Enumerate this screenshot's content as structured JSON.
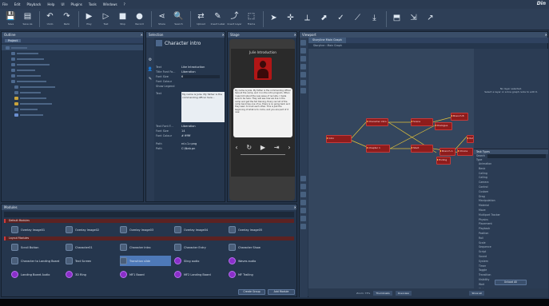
{
  "menu": [
    "File",
    "Edit",
    "Playback",
    "Help",
    "UI",
    "Plugins",
    "Tools",
    "Windows",
    "?"
  ],
  "toolbar": [
    {
      "icon": "💾",
      "label": "Save"
    },
    {
      "icon": "▤",
      "label": "Save As"
    },
    {
      "icon": "↶",
      "label": "Undo"
    },
    {
      "icon": "↷",
      "label": "Redo"
    },
    {
      "icon": "▶",
      "label": "Play"
    },
    {
      "icon": "▷",
      "label": "Test"
    },
    {
      "icon": "■",
      "label": "Stop"
    },
    {
      "icon": "●",
      "label": "Record"
    },
    {
      "icon": "⋖",
      "label": "Share"
    },
    {
      "icon": "🔍",
      "label": "Search"
    },
    {
      "icon": "⇄",
      "label": "Upload"
    },
    {
      "icon": "✎",
      "label": "Insert Label"
    },
    {
      "icon": "⤴",
      "label": "Insert Layer"
    },
    {
      "icon": "⬚",
      "label": "Frame"
    },
    {
      "icon": "➤",
      "label": ""
    },
    {
      "icon": "✛",
      "label": ""
    },
    {
      "icon": "⟂",
      "label": ""
    },
    {
      "icon": "⬈",
      "label": ""
    },
    {
      "icon": "✓",
      "label": ""
    },
    {
      "icon": "⟋",
      "label": ""
    },
    {
      "icon": "⤓",
      "label": ""
    },
    {
      "icon": "⬒",
      "label": ""
    },
    {
      "icon": "⇲",
      "label": ""
    },
    {
      "icon": "↗",
      "label": ""
    }
  ],
  "logo": "Din",
  "left_panel": {
    "title": "Outline",
    "tab": "Project"
  },
  "selection_panel": {
    "title": "Selection",
    "header": "Character intro"
  },
  "properties": [
    {
      "k": "Text",
      "v": "Like Introduction"
    },
    {
      "k": "Title Font Fa...",
      "v": "Liberation"
    },
    {
      "k": "Font Size",
      "v": "6"
    },
    {
      "k": "Font Colour",
      "v": ""
    },
    {
      "k": "Show Legend",
      "v": ""
    },
    {
      "k": "Text",
      "v": "My name is Julie. My father is the commanding officer here..."
    },
    {
      "k": "Text Font F...",
      "v": "Liberation"
    },
    {
      "k": "Font Size",
      "v": "14"
    },
    {
      "k": "Font Colour",
      "v": "# ffffff"
    },
    {
      "k": "Path",
      "v": "rd.r.1.r.png"
    },
    {
      "k": "Path",
      "v": "C:\\Nab.pn"
    }
  ],
  "stage": {
    "title": "Stage",
    "card_title": "Julie Introduction",
    "body": "My name is Julie. My father is the commanding officer here at the camp, and I run the intro program. When I was told about the new wave of recruits, I made sure to be here. They will see how we live in the camp and get the full training. Every recruit of the camp becomes one of us, there is no going back and they learn to trust each other. This is just the beginning of what is to come, and you are part of it now."
  },
  "graph_panel": {
    "title": "Viewport",
    "tab": "Storyline Main Graph",
    "crumb1": "Storyline",
    "crumb2": "Main Graph",
    "hint1": "No layer selected.",
    "hint2": "Select a layer or a line graph node to edit it.",
    "zoom": "Zoom: 73%",
    "btn_thumbs": "Thumbnails",
    "btn_overview": "Overview",
    "btn_show": "Show all"
  },
  "nodes": [
    {
      "label": "Intro"
    },
    {
      "label": "Character intro"
    },
    {
      "label": "Chapter 1"
    },
    {
      "label": "Scene"
    },
    {
      "label": "Start"
    },
    {
      "label": "Dialogue"
    },
    {
      "label": "Branch A"
    },
    {
      "label": "Branch B"
    },
    {
      "label": "Choice"
    },
    {
      "label": "Outro"
    },
    {
      "label": "Ending"
    }
  ],
  "task_panel": {
    "title": "Task Types",
    "search_label": "Search",
    "type_label": "Type",
    "btn": "Unload All"
  },
  "task_types": [
    "Animation",
    "Basic",
    "Calling",
    "Calling",
    "Camera",
    "Control",
    "Custom",
    "Drag",
    "Manipulation",
    "Material",
    "Move",
    "Multipart Tracker",
    "Physics",
    "Placement",
    "Playback",
    "Position",
    "Roll",
    "Scale",
    "Sequence",
    "Script",
    "Sound",
    "System",
    "Timer",
    "Toggle",
    "Transition",
    "Visibility",
    "Wait",
    "Web"
  ],
  "modules_panel": {
    "title": "Modules",
    "search_placeholder": "",
    "section1": "Default Modules",
    "section2": "Layout Modules",
    "btn_create": "Create Group",
    "btn_add": "Add Module"
  },
  "modules_row1": [
    "Overlay Image01",
    "Overlay Image02",
    "Overlay Image03",
    "Overlay Image04",
    "Overlay Image05"
  ],
  "modules_grid": [
    [
      "Scroll Button",
      "Character01",
      "Character Intro",
      "Character Entry",
      "Character Show"
    ],
    [
      "Character to Landing Board",
      "Text Screen",
      "Transition slide",
      "Sling audio",
      "Waves audio"
    ],
    [
      "Landing Board Audio",
      "3D Ring",
      "MF1 Board",
      "MF2 Landing Board",
      "MF Trailing"
    ]
  ],
  "colors": {
    "accent": "#4e79b8",
    "node": "#8e1c1c",
    "edge": "#e3c33a"
  }
}
